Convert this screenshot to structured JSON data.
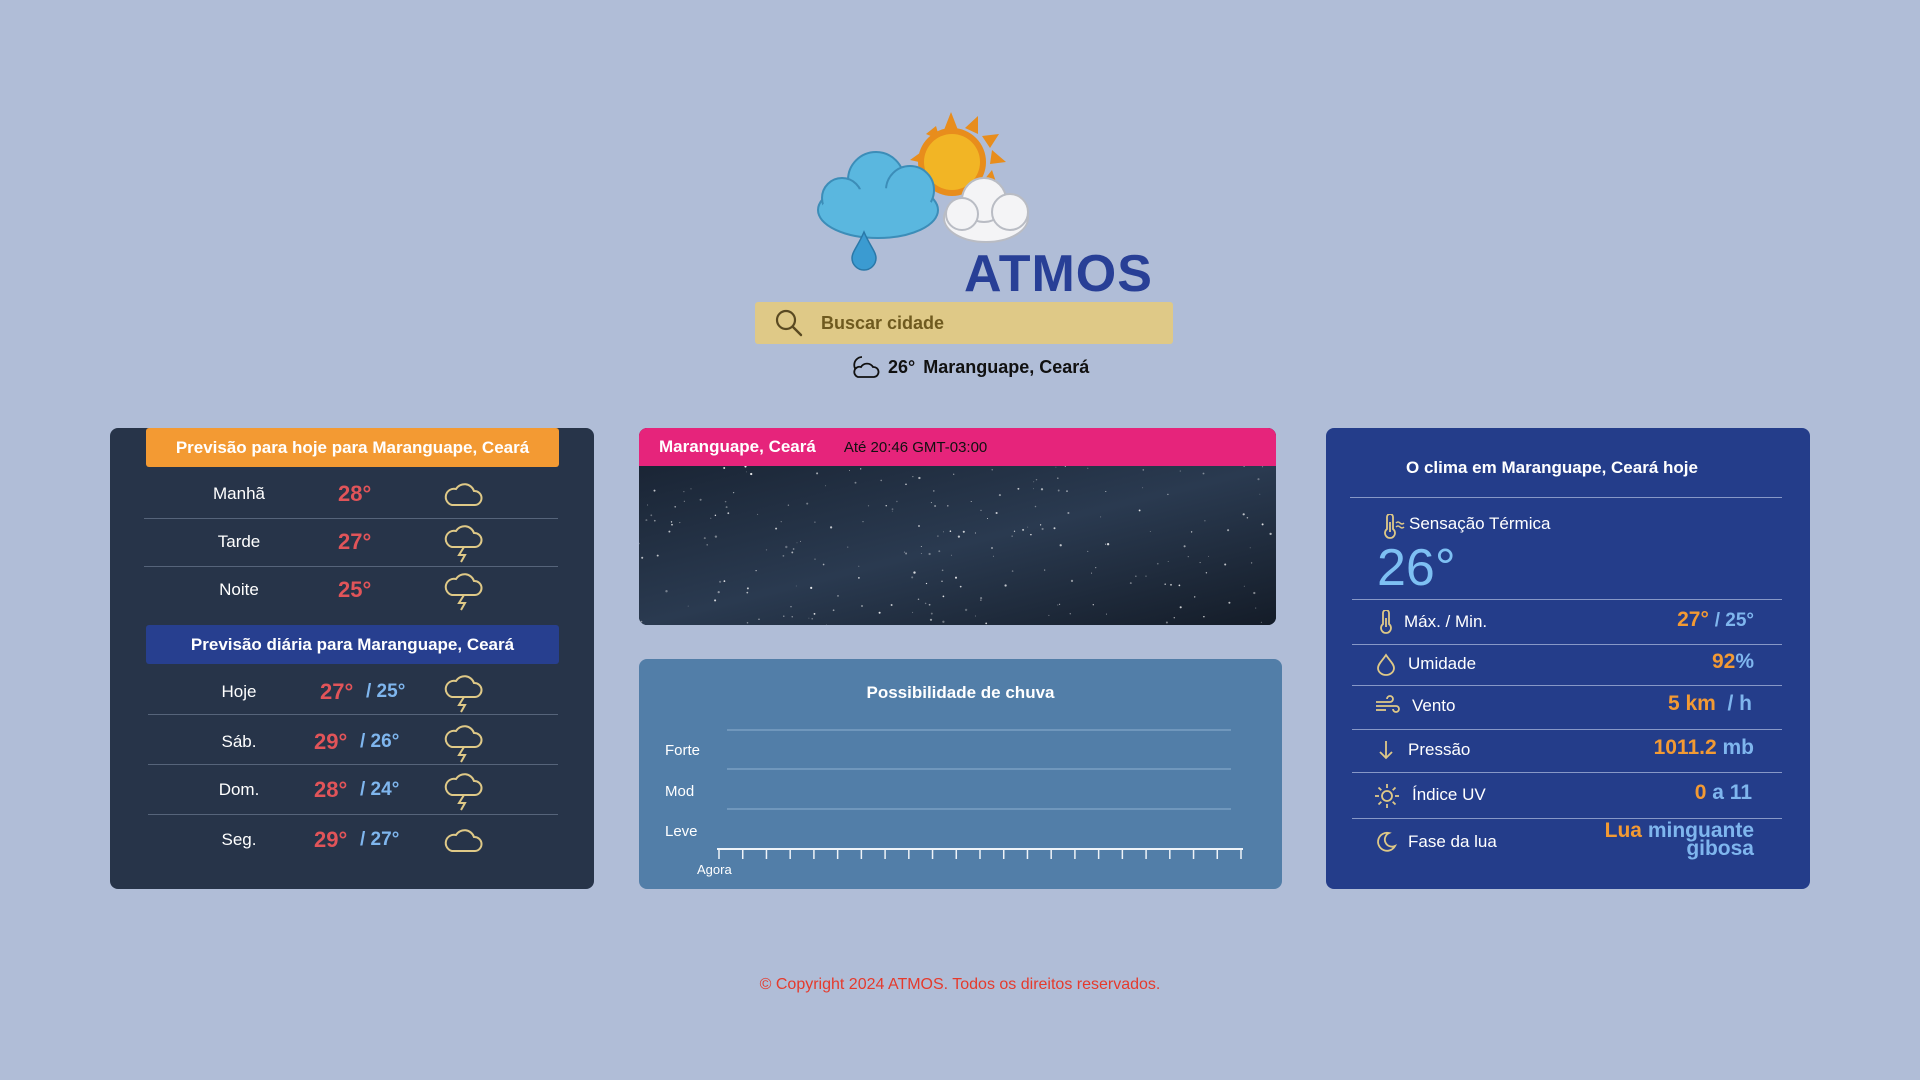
{
  "app": {
    "name": "ATMOS"
  },
  "search": {
    "placeholder": "Buscar cidade"
  },
  "current": {
    "temp": "26°",
    "location": "Maranguape, Ceará",
    "icon": "cloudy-night-icon"
  },
  "today": {
    "title": "Previsão para hoje para Maranguape, Ceará",
    "periods": [
      {
        "label": "Manhã",
        "temp": "28°",
        "icon": "cloud-icon"
      },
      {
        "label": "Tarde",
        "temp": "27°",
        "icon": "thunderstorm-icon"
      },
      {
        "label": "Noite",
        "temp": "25°",
        "icon": "thunderstorm-icon"
      }
    ]
  },
  "daily": {
    "title": "Previsão diária para Maranguape, Ceará",
    "days": [
      {
        "label": "Hoje",
        "max": "27°",
        "min": "/ 25°",
        "icon": "thunderstorm-icon"
      },
      {
        "label": "Sáb.",
        "max": "29°",
        "min": "/ 26°",
        "icon": "thunderstorm-icon"
      },
      {
        "label": "Dom.",
        "max": "28°",
        "min": "/ 24°",
        "icon": "thunderstorm-icon"
      },
      {
        "label": "Seg.",
        "max": "29°",
        "min": "/ 27°",
        "icon": "cloud-icon"
      }
    ]
  },
  "sky": {
    "city": "Maranguape, Ceará",
    "until": "Até 20:46 GMT-03:00"
  },
  "rain": {
    "title": "Possibilidade de chuva",
    "levels": [
      "Forte",
      "Mod",
      "Leve"
    ],
    "start_label": "Agora"
  },
  "conditions": {
    "title": "O clima em Maranguape, Ceará hoje",
    "feels_like_label": "Sensação Térmica",
    "feels_like_value": "26°",
    "max_min_label": "Máx. / Min.",
    "max": "27°",
    "min": "/ 25°",
    "humidity_label": "Umidade",
    "humidity_value": "92",
    "humidity_unit": "%",
    "wind_label": "Vento",
    "wind_value": "5 km",
    "wind_unit": "/ h",
    "pressure_label": "Pressão",
    "pressure_value": "1011.2",
    "pressure_unit": "mb",
    "uv_label": "Índice UV",
    "uv_value": "0",
    "uv_scale": "a 11",
    "moon_label": "Fase da lua",
    "moon_word1": "Lua",
    "moon_word2": "minguante",
    "moon_word3": "gibosa"
  },
  "colors": {
    "background": "#b0bdd7",
    "accent_orange": "#f39a33",
    "accent_pink": "#e6247b",
    "brand_blue": "#283f96",
    "temp_max": "#e15459",
    "temp_min": "#7fb6ee"
  },
  "footer": {
    "text": "© Copyright 2024 ATMOS. Todos os direitos reservados."
  }
}
